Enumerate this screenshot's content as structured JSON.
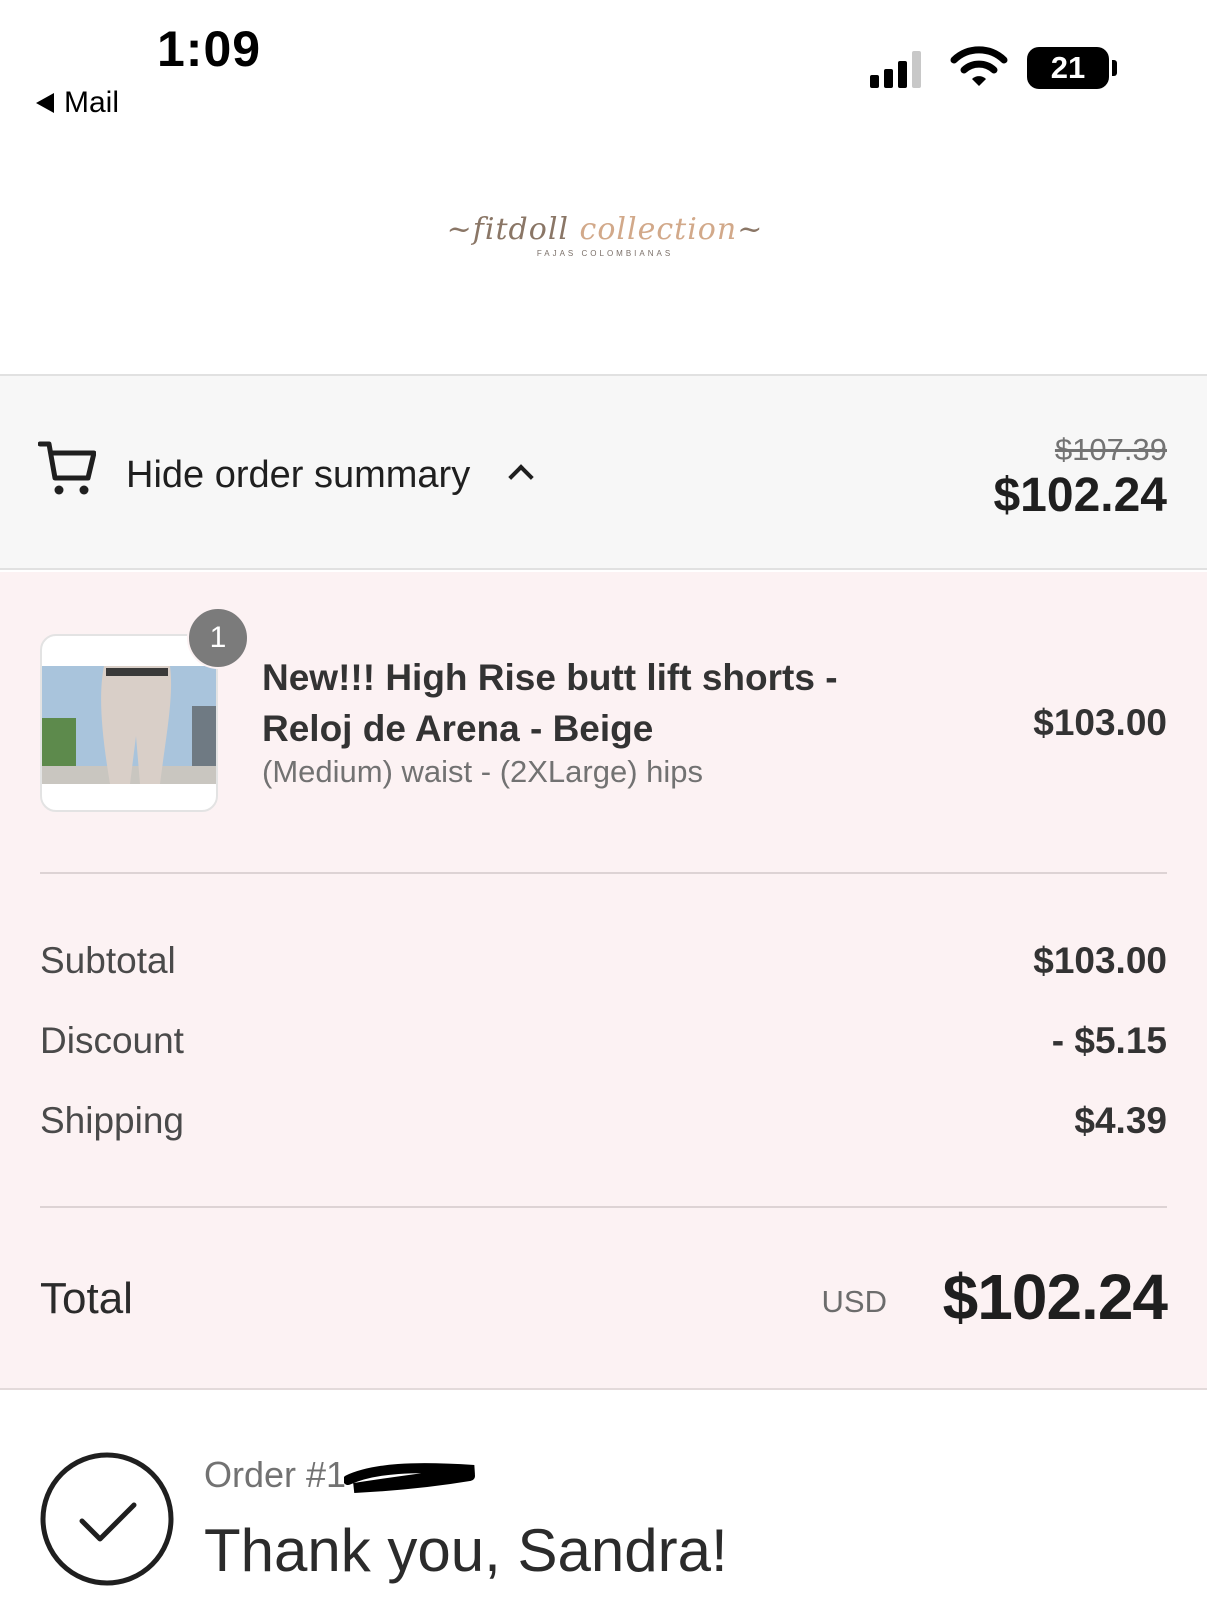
{
  "status_bar": {
    "time": "1:09",
    "back_app": "Mail",
    "battery": "21"
  },
  "logo": {
    "script_part1": "fitdoll ",
    "script_part2": "collection",
    "subtitle": "FAJAS COLOMBIANAS"
  },
  "summary_toggle": {
    "label": "Hide order summary",
    "original_price": "$107.39",
    "total_price": "$102.24"
  },
  "line_item": {
    "quantity": "1",
    "name": "New!!! High Rise butt lift shorts - Reloj de Arena - Beige",
    "variant": "(Medium) waist - (2XLarge) hips",
    "price": "$103.00"
  },
  "costs": {
    "subtotal_label": "Subtotal",
    "subtotal_value": "$103.00",
    "discount_label": "Discount",
    "discount_value": "- $5.15",
    "shipping_label": "Shipping",
    "shipping_value": "$4.39",
    "total_label": "Total",
    "currency": "USD",
    "total_value": "$102.24"
  },
  "confirmation": {
    "order_number": "Order #1",
    "thank_you": "Thank you, Sandra!"
  },
  "colors": {
    "panel_background": "#fcf2f3",
    "summary_background": "#f7f7f7",
    "badge": "#7b7b7b"
  }
}
